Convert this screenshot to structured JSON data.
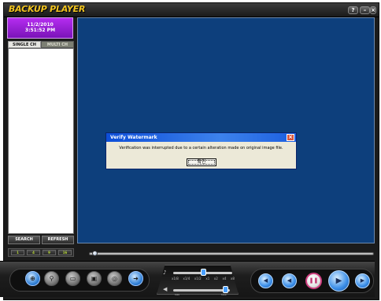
{
  "app": {
    "title": "BACKUP PLAYER"
  },
  "window_controls": {
    "help": "?",
    "minimize": "–",
    "close": "×"
  },
  "left_panel": {
    "date": "11/2/2010",
    "time": "3:51:52 PM",
    "tabs": [
      {
        "label": "SINGLE CH",
        "active": true
      },
      {
        "label": "MULTI CH",
        "active": false
      }
    ],
    "search_label": "SEARCH",
    "refresh_label": "REFRESH",
    "split_buttons": [
      "1",
      "4",
      "9",
      "16"
    ]
  },
  "dialog": {
    "title": "Verify Watermark",
    "message": "Verification was interrupted due to a certain alteration made on original image file.",
    "ok_label": "확인"
  },
  "speed_panel": {
    "ticks": [
      "x1/8",
      "x1/4",
      "x1/2",
      "x1",
      "x2",
      "x4",
      "x8"
    ],
    "volume_min_label": "MIN",
    "volume_max_label": "MAX"
  },
  "toolbar": {
    "tools": [
      {
        "icon": "zoom-icon",
        "active": true
      },
      {
        "icon": "search-icon",
        "active": false
      },
      {
        "icon": "print-icon",
        "active": false
      },
      {
        "icon": "save-icon",
        "active": false
      },
      {
        "icon": "watermark-icon",
        "active": false
      },
      {
        "icon": "export-icon",
        "active": true
      }
    ]
  },
  "playback": {
    "buttons": [
      "step-back-icon",
      "rewind-icon",
      "pause-icon",
      "play-icon",
      "step-forward-icon"
    ]
  },
  "colors": {
    "title_accent": "#f2c521",
    "date_box": "#9b1fd6",
    "video_background": "#0d3f7c",
    "playback_blue": "#3b8ee8"
  }
}
